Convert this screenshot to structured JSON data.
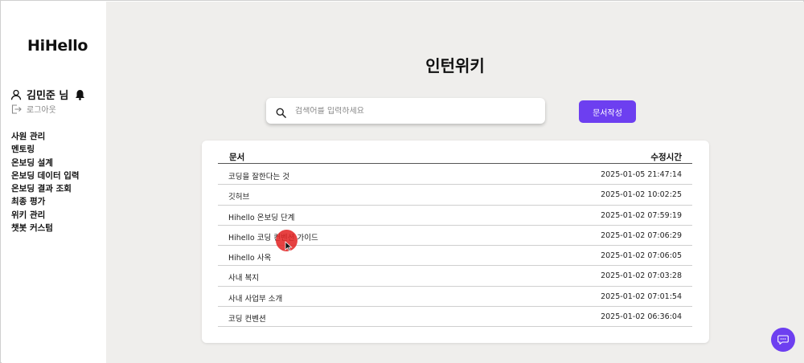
{
  "sidebar": {
    "logo": "HiHello",
    "user_name": "김민준 님",
    "logout_label": "로그아웃",
    "nav": [
      {
        "label": "사원 관리"
      },
      {
        "label": "멘토링"
      },
      {
        "label": "온보딩 설계"
      },
      {
        "label": "온보딩 데이터 입력"
      },
      {
        "label": "온보딩 결과 조회"
      },
      {
        "label": "최종 평가"
      },
      {
        "label": "위키 관리"
      },
      {
        "label": "챗봇 커스텀"
      }
    ]
  },
  "main": {
    "title": "인턴위키",
    "search": {
      "placeholder": "검색어를 입력하세요",
      "value": ""
    },
    "write_button": "문서작성",
    "table": {
      "columns": [
        "문서",
        "수정시간"
      ],
      "rows": [
        {
          "title": "코딩을 잘한다는 것",
          "time": "2025-01-05 21:47:14"
        },
        {
          "title": "깃허브",
          "time": "2025-01-02 10:02:25"
        },
        {
          "title": "Hihello 온보딩 단계",
          "time": "2025-01-02 07:59:19"
        },
        {
          "title": "Hihello 코딩 컨벤션 가이드",
          "time": "2025-01-02 07:06:29"
        },
        {
          "title": "Hihello 사옥",
          "time": "2025-01-02 07:06:05"
        },
        {
          "title": "사내 복지",
          "time": "2025-01-02 07:03:28"
        },
        {
          "title": "사내 사업부 소개",
          "time": "2025-01-02 07:01:54"
        },
        {
          "title": "코딩 컨벤션",
          "time": "2025-01-02 06:36:04"
        }
      ]
    }
  },
  "icons": {
    "user": "user-icon",
    "bell": "bell-icon",
    "logout": "logout-icon",
    "search": "search-icon",
    "chat": "chat-icon",
    "cursor": "cursor-icon"
  },
  "colors": {
    "accent": "#6d3ff0",
    "main_bg": "#efeeec",
    "click_indicator": "#e22828"
  }
}
